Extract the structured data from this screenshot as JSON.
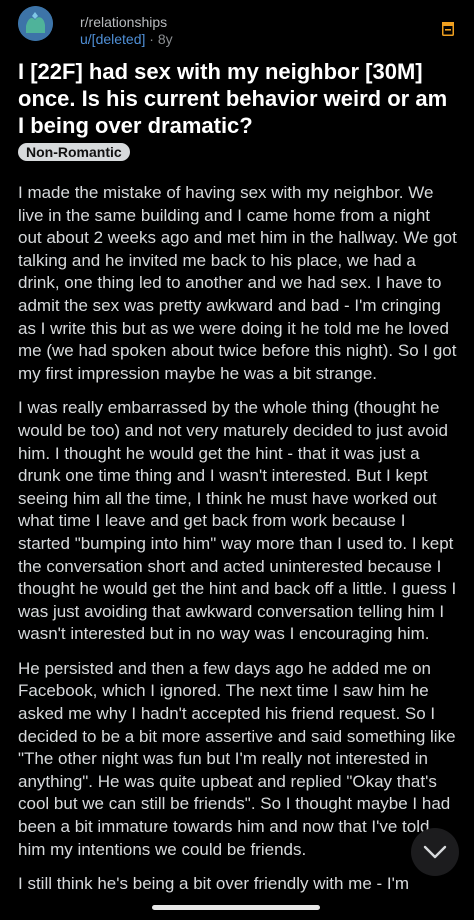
{
  "post": {
    "subreddit": "r/relationships",
    "author": "u/[deleted]",
    "separator": "·",
    "age": "8y",
    "title": "I [22F] had sex with my neighbor [30M] once. Is his current behavior weird or am I being over dramatic?",
    "flair": "Non-Romantic",
    "paragraphs": [
      "I made the mistake of having sex with my neighbor. We live in the same building and I came home from a night out about 2 weeks ago and met him in the hallway. We got talking and he invited me back to his place, we had a drink, one thing led to another and we had sex. I have to admit the sex was pretty awkward and bad - I'm cringing as I write this but as we were doing it he told me he loved me (we had spoken about twice before this night). So I got my first impression maybe he was a bit strange.",
      "I was really embarrassed by the whole thing (thought he would be too) and not very maturely decided to just avoid him. I thought he would get the hint - that it was just a drunk one time thing and I wasn't interested. But I kept seeing him all the time, I think he must have worked out what time I leave and get back from work because I started \"bumping into him\" way more than I used to. I kept the conversation short and acted uninterested because I thought he would get the hint and back off a little. I guess I was just avoiding that awkward conversation telling him I wasn't interested but in no way was I encouraging him.",
      "He persisted and then a few days ago he added me on Facebook, which I ignored. The next time I saw him he asked me why I hadn't accepted his friend request. So I decided to be a bit more assertive and said something like \"The other night was fun but I'm really not interested in anything\". He was quite upbeat and replied \"Okay that's cool but we can still be friends\". So I thought maybe I had been a bit immature towards him and now that I've told him my intentions we could be friends.",
      "I still think he's being a bit over friendly with me - I'm"
    ]
  },
  "colors": {
    "background": "#000000",
    "text": "#d7dadc",
    "username": "#4f8fd6",
    "save_icon": "#f0a020",
    "avatar": "#3d74a8"
  },
  "icons": {
    "avatar": "subreddit-avatar",
    "save": "bookmark-save-icon",
    "scroll": "chevron-down-icon"
  }
}
